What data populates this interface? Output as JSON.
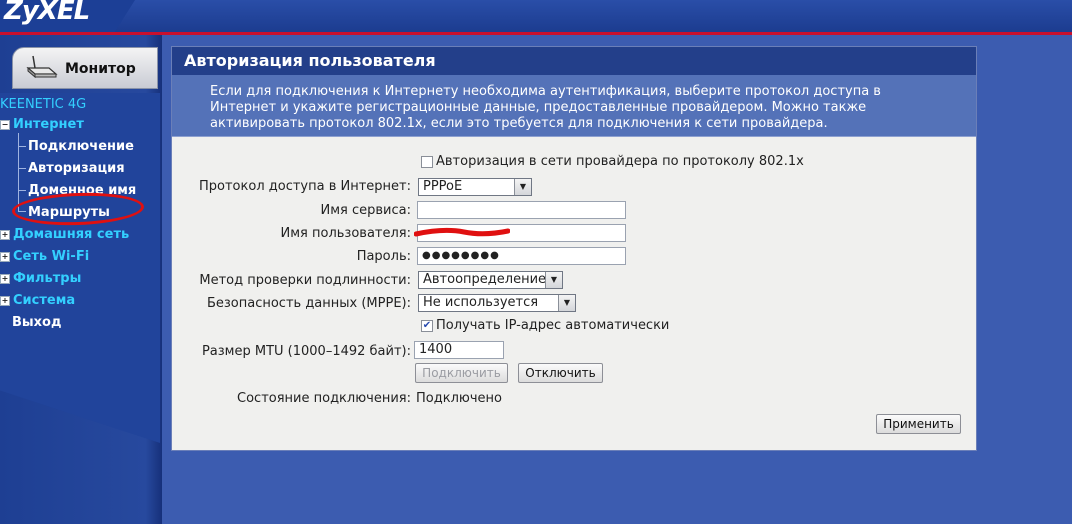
{
  "brand": {
    "logo": "ZyXEL"
  },
  "sidebar": {
    "monitor_label": "Монитор",
    "device_name": "KEENETIC 4G",
    "items": [
      {
        "label": "Интернет"
      },
      {
        "label": "Подключение"
      },
      {
        "label": "Авторизация"
      },
      {
        "label": "Доменное имя"
      },
      {
        "label": "Маршруты"
      },
      {
        "label": "Домашняя сеть"
      },
      {
        "label": "Сеть Wi-Fi"
      },
      {
        "label": "Фильтры"
      },
      {
        "label": "Система"
      },
      {
        "label": "Выход"
      }
    ]
  },
  "panel": {
    "title": "Авторизация пользователя",
    "description": [
      "Если для подключения к Интернету необходима аутентификация, выберите протокол доступа в",
      "Интернет и укажите регистрационные данные, предоставленные провайдером. Можно также",
      "активировать протокол 802.1x, если это требуется для подключения к сети провайдера."
    ],
    "dot1x_label": "Авторизация в сети провайдера по протоколу 802.1x",
    "protocol_label": "Протокол доступа в Интернет:",
    "protocol_value": "PPPoE",
    "service_label": "Имя сервиса:",
    "service_value": "",
    "username_label": "Имя пользователя:",
    "username_value": "",
    "password_label": "Пароль:",
    "password_value": "●●●●●●●●",
    "auth_label": "Метод проверки подлинности:",
    "auth_value": "Автоопределение",
    "security_label": "Безопасность данных (MPPE):",
    "security_value": "Не используется",
    "auto_ip_label": "Получать IP-адрес автоматически",
    "mtu_label": "Размер MTU (1000–1492 байт):",
    "mtu_value": "1400",
    "connect_label": "Подключить",
    "disconnect_label": "Отключить",
    "status_label": "Состояние подключения:",
    "status_value": "Подключено",
    "apply_label": "Применить"
  }
}
